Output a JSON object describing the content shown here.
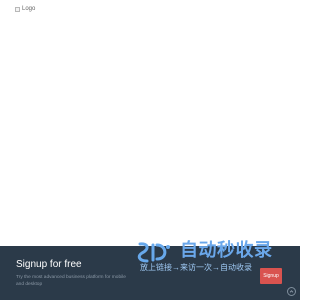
{
  "header": {
    "logo_alt": "Logo"
  },
  "footer": {
    "signup_title": "Signup for free",
    "signup_description": "Try the most advanced business platform for mobile and desktop",
    "signup_button": "Signup"
  },
  "watermark": {
    "main_text": "自动秒收录",
    "sub_text": "放上链接→来访一次→自动收录"
  },
  "icons": {
    "logo": "broken-image-icon",
    "watermark": "watermark-logo-icon",
    "scroll": "chevron-up-icon"
  },
  "colors": {
    "footer_background": "#2b3a49",
    "accent": "#d9534f",
    "watermark_blue": "#6aa7ea"
  }
}
